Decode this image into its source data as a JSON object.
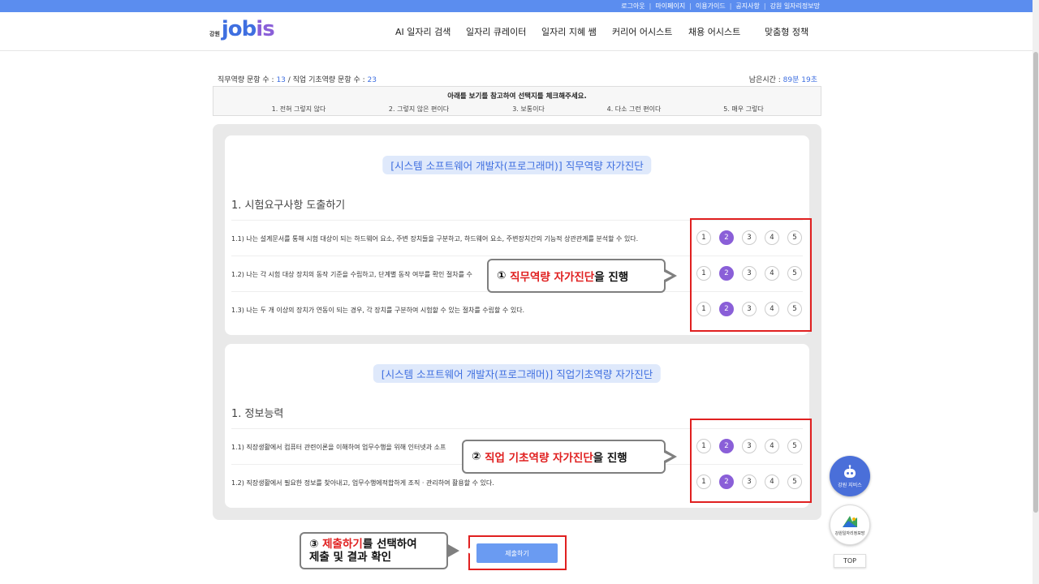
{
  "toplinks": [
    "로그아웃",
    "마이페이지",
    "이용가이드",
    "공지사항",
    "강원 일자리정보망"
  ],
  "logo": {
    "prefix": "강원",
    "name_a": "job",
    "name_b": "is"
  },
  "nav": [
    "AI 일자리 검색",
    "일자리 큐레이터",
    "일자리 지혜 쌤",
    "커리어 어시스트",
    "채용 어시스트",
    "맞춤형 정책"
  ],
  "counts": {
    "label_a": "직무역량 문항 수 : ",
    "value_a": "13",
    "sep": " / ",
    "label_b": "직업 기초역량 문항 수 : ",
    "value_b": "23"
  },
  "timer": {
    "label": "남은시간 : ",
    "value": "89분 19초"
  },
  "guide": {
    "title": "아래를 보기를 참고하여 선택지를 체크해주세요.",
    "options": [
      "1. 전혀 그렇지 않다",
      "2. 그렇지 않은 편이다",
      "3. 보통이다",
      "4. 다소 그런 편이다",
      "5. 매우 그렇다"
    ]
  },
  "card1": {
    "title": "[시스템 소프트웨어 개발자(프로그래머)] 직무역량 자가진단",
    "section": "1. 시험요구사항 도출하기",
    "questions": [
      {
        "text": "1.1) 나는 설계문서를 통해 시험 대상이 되는 하드웨어 요소, 주변 장치들을 구분하고, 하드웨어 요소, 주변장치간의 기능적 상관관계를 분석할 수 있다.",
        "selected": 2
      },
      {
        "text": "1.2) 나는 각 시험 대상 장치의 동작 기준을 수립하고, 단계별 동작 여부를 확인 절차를 수",
        "selected": 2
      },
      {
        "text": "1.3) 나는 두 개 이상의 장치가 연동이 되는 경우, 각 장치를 구분하여 시험할 수 있는 절차를 수립할 수 있다.",
        "selected": 2
      }
    ]
  },
  "card2": {
    "title": "[시스템 소프트웨어 개발자(프로그래머)] 직업기초역량 자가진단",
    "section": "1. 정보능력",
    "questions": [
      {
        "text": "1.1) 직장생활에서 컴퓨터 관련이론을 이해하여 업무수행을 위해 인터넷과 소프",
        "selected": 2
      },
      {
        "text": "1.2) 직장생활에서 필요한 정보를 찾아내고, 업무수행에적합하게 조직 · 관리하여 활용할 수 있다.",
        "selected": 2
      }
    ]
  },
  "choices": [
    "1",
    "2",
    "3",
    "4",
    "5"
  ],
  "callout1": {
    "num": "①",
    "red": "직무역량 자가진단",
    "rest": "을 진행"
  },
  "callout2": {
    "num": "②",
    "red": "직업 기초역량 자가진단",
    "rest": "을 진행"
  },
  "callout3": {
    "num": "③",
    "red": "제출하기",
    "rest": "를 선택하여",
    "line2": "제출 및 결과 확인"
  },
  "submit_label": "제출하기",
  "fab1_label": "강원 지비스",
  "fab2_label": "강원일자리정보망",
  "top_label": "TOP",
  "colors": {
    "accent": "#5b8def",
    "selected": "#8a5fd8",
    "highlight": "#e02020"
  }
}
